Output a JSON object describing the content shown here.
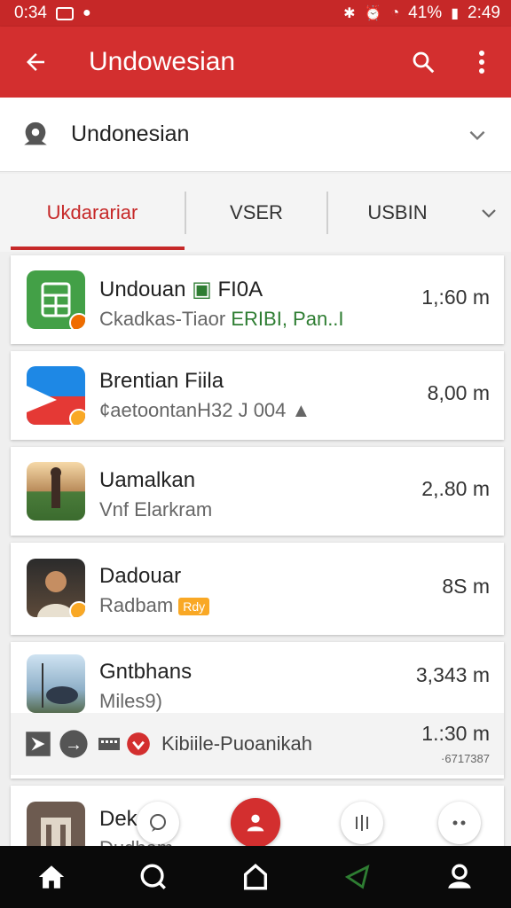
{
  "status_bar": {
    "time_left": "0:34",
    "time_right": "2:49",
    "battery": "41%"
  },
  "app_bar": {
    "title": "Undowesian"
  },
  "selector": {
    "label": "Undonesian"
  },
  "tabs": [
    {
      "label": "Ukdarariar",
      "active": true
    },
    {
      "label": "VSER",
      "active": false
    },
    {
      "label": "USBIN",
      "active": false
    }
  ],
  "items": [
    {
      "name": "Undouan",
      "name_suffix": "FI0A",
      "sub_a": "Ckadkas-Tiaor",
      "sub_b": "ERIBI, Pan..I",
      "distance": "1,:60 m"
    },
    {
      "name": "Brentian Fiila",
      "sub_a": "¢aetoontanH32 J 004",
      "distance": "8,00 m"
    },
    {
      "name": "Uamalkan",
      "sub_a": "Vnf Elarkram",
      "distance": "2,.80 m"
    },
    {
      "name": "Dadouar",
      "sub_a": "Radbam",
      "chip": "Rdy",
      "distance": "8S m"
    },
    {
      "name": "Gntbhans",
      "sub_a": "Miles9)",
      "distance": "3,343 m"
    },
    {
      "name": "Dek",
      "sub_a": "Dudham"
    }
  ],
  "bottom_row": {
    "label": "Kibiile-Puoanikah",
    "distance": "1.:30 m",
    "sub": "·6717387"
  },
  "colors": {
    "primary": "#d32f2f",
    "status": "#c62828",
    "accent_green": "#2e7d32",
    "accent_blue": "#1565c0",
    "nav_bg": "#0a0a0a"
  }
}
